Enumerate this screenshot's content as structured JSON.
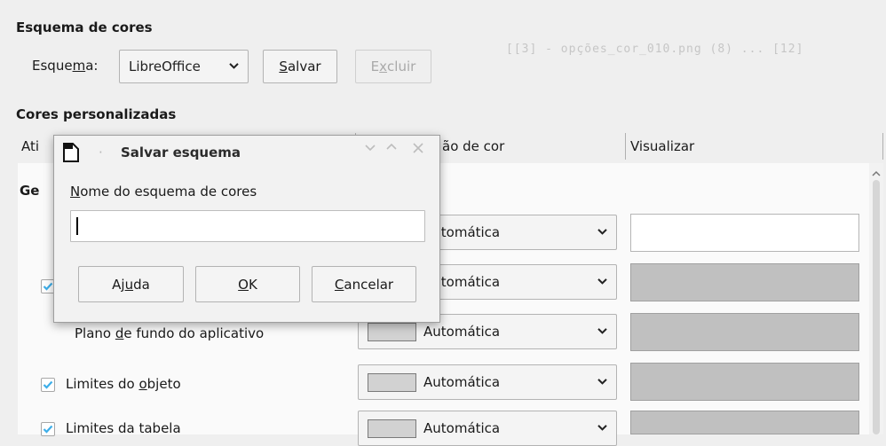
{
  "scheme_section": {
    "title": "Esquema de cores",
    "scheme_label_pre": "Esque",
    "scheme_label_u": "m",
    "scheme_label_post": "a:",
    "scheme_value": "LibreOffice",
    "save_u": "S",
    "save_post": "alvar",
    "delete_pre": "E",
    "delete_u": "x",
    "delete_post": "cluir"
  },
  "background_ghost_text": "[[3] - opções_cor_010.png (8) ... [12]",
  "custom_section": {
    "title": "Cores personalizadas",
    "col_active_partial": "Ati",
    "col_color_partial": "ão de cor",
    "col_preview": "Visualizar",
    "group_partial": "Ge"
  },
  "rows": [
    {
      "label_pre": "",
      "label_u": "",
      "label_post": "",
      "color": "Automática",
      "checked": false
    },
    {
      "label_pre": "",
      "label_u": "",
      "label_post": "",
      "color": "Automática",
      "checked": true
    },
    {
      "label_pre": "Plano ",
      "label_u": "d",
      "label_post": "e fundo do aplicativo",
      "color": "Automática",
      "checked": null
    },
    {
      "label_pre": "Limites do ",
      "label_u": "o",
      "label_post": "bjeto",
      "color": "Automática",
      "checked": true
    },
    {
      "label_pre": "Limites da tabela",
      "label_u": "",
      "label_post": "",
      "color": "Automática",
      "checked": true
    }
  ],
  "dialog": {
    "title": "Salvar esquema",
    "field_label_u": "N",
    "field_label_post": "ome do esquema de cores",
    "field_value": "",
    "help_pre": "Aj",
    "help_u": "u",
    "help_post": "da",
    "ok_u": "O",
    "ok_post": "K",
    "cancel_u": "C",
    "cancel_post": "ancelar"
  },
  "colors": {
    "check_accent": "#3daee9",
    "preview_white": "#ffffff",
    "preview_gray": "#c0c0c0"
  }
}
